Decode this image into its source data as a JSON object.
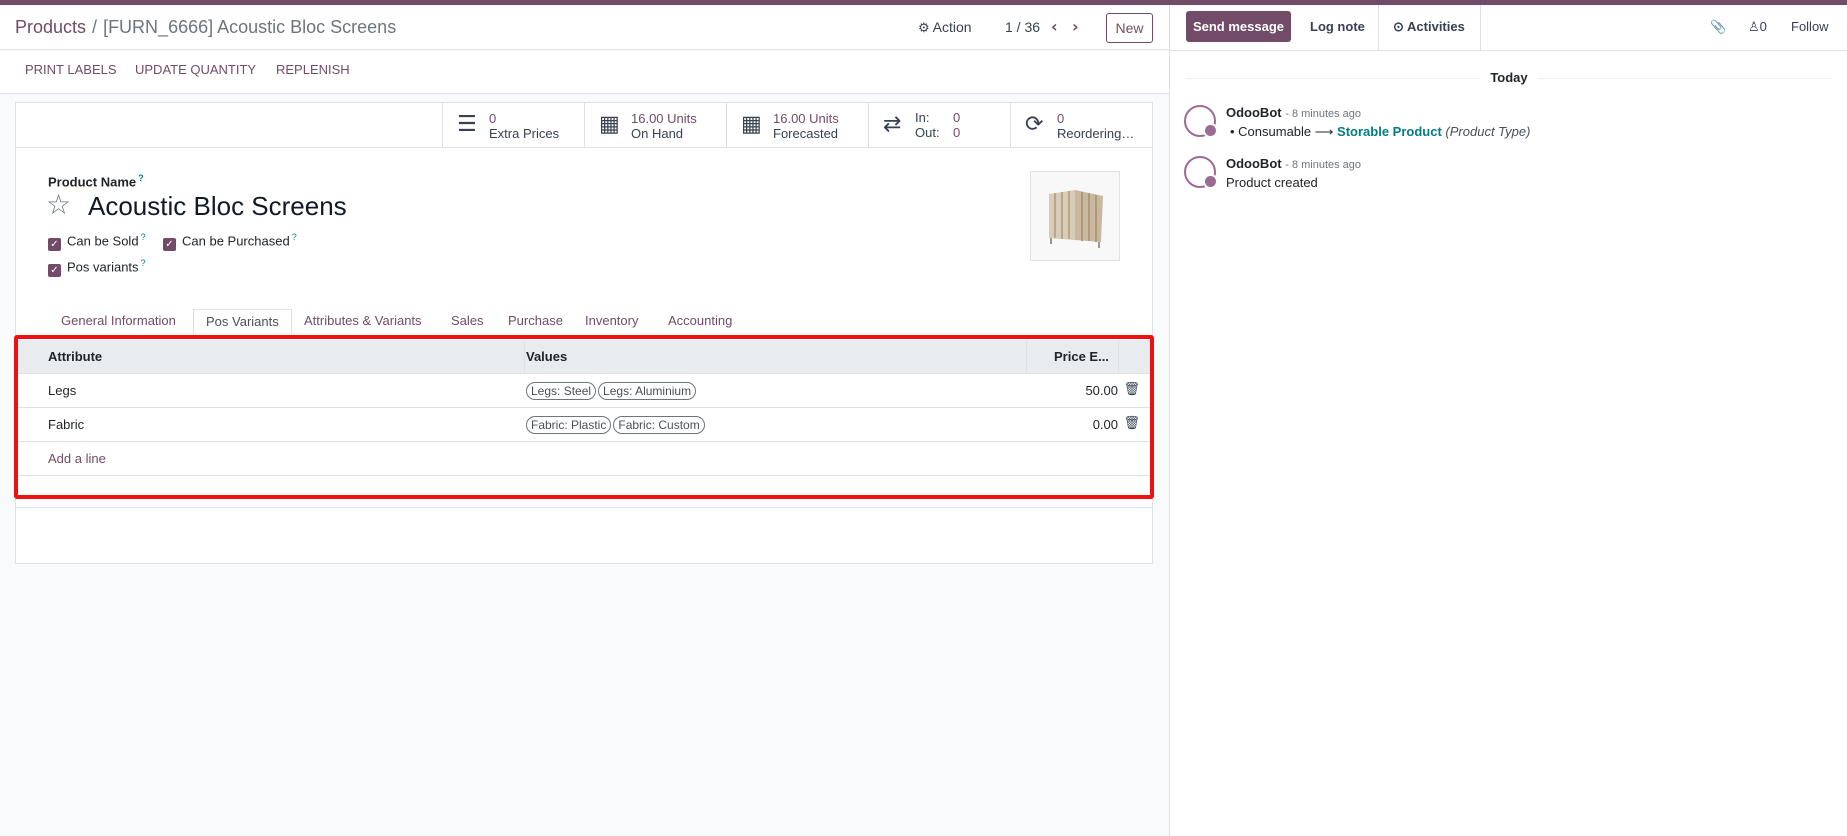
{
  "breadcrumb": {
    "parent": "Products",
    "current": "[FURN_6666] Acoustic Bloc Screens"
  },
  "control": {
    "action_label": "Action",
    "pager": "1 / 36",
    "new_label": "New"
  },
  "statusbar": {
    "buttons": [
      "PRINT LABELS",
      "UPDATE QUANTITY",
      "REPLENISH"
    ]
  },
  "smart_buttons": [
    {
      "value": "0",
      "label": "Extra Prices",
      "icon": "list-icon"
    },
    {
      "value": "16.00 Units",
      "label": "On Hand",
      "icon": "cubes-icon"
    },
    {
      "value": "16.00 Units",
      "label": "Forecasted",
      "icon": "cubes-icon"
    },
    {
      "in_label": "In:",
      "in_value": "0",
      "out_label": "Out:",
      "out_value": "0",
      "icon": "exchange-icon"
    },
    {
      "value": "0",
      "label": "Reordering…",
      "icon": "refresh-icon"
    }
  ],
  "form": {
    "name_label": "Product Name",
    "help_mark": "?",
    "product_name": "Acoustic Bloc Screens",
    "checkboxes": [
      "Can be Sold",
      "Can be Purchased",
      "Pos variants"
    ]
  },
  "tabs": [
    "General Information",
    "Pos Variants",
    "Attributes & Variants",
    "Sales",
    "Purchase",
    "Inventory",
    "Accounting"
  ],
  "table": {
    "headers": [
      "Attribute",
      "Values",
      "Price E..."
    ],
    "rows": [
      {
        "attribute": "Legs",
        "values": [
          "Legs: Steel",
          "Legs: Aluminium"
        ],
        "price": "50.00"
      },
      {
        "attribute": "Fabric",
        "values": [
          "Fabric: Plastic",
          "Fabric: Custom"
        ],
        "price": "0.00"
      }
    ],
    "add_line": "Add a line"
  },
  "chatter": {
    "send_message": "Send message",
    "log_note": "Log note",
    "activities": "Activities",
    "followers_count": "0",
    "follow": "Follow",
    "today": "Today",
    "messages": [
      {
        "author": "OdooBot",
        "date": "- 8 minutes ago",
        "from": "Consumable",
        "to": "Storable Product",
        "field": "(Product Type)"
      },
      {
        "author": "OdooBot",
        "date": "- 8 minutes ago",
        "body": "Product created"
      }
    ]
  },
  "colors": {
    "brand": "#714b67",
    "highlight": "#ee1111",
    "teal": "#017e84"
  }
}
